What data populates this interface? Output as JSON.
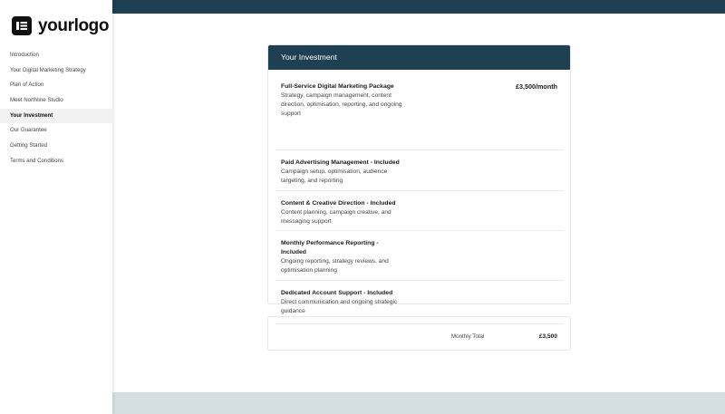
{
  "brand": {
    "logo_text": "yourlogo"
  },
  "nav": {
    "items": [
      {
        "label": "Introduction"
      },
      {
        "label": "Your Digital Marketing Strategy"
      },
      {
        "label": "Plan of Action"
      },
      {
        "label": "Meet Northline Studio"
      },
      {
        "label": "Your Investment"
      },
      {
        "label": "Our Guarantee"
      },
      {
        "label": "Getting Started"
      },
      {
        "label": "Terms and Conditions"
      }
    ],
    "active": "Your Investment"
  },
  "investment": {
    "header": "Your Investment",
    "items": [
      {
        "title": "Full-Service Digital Marketing Package",
        "description": "Strategy, campaign management, content direction, optimisation, reporting, and ongoing support",
        "price": "£3,500/month"
      },
      {
        "title": "Paid Advertising Management - Included",
        "description": "Campaign setup, optimisation, audience targeting, and reporting"
      },
      {
        "title": "Content & Creative Direction - Included",
        "description": "Content planning, campaign creative, and messaging support"
      },
      {
        "title": "Monthly Performance Reporting - Included",
        "description": "Ongoing reporting, strategy reviews, and optimisation planning"
      },
      {
        "title": "Dedicated Account Support - Included",
        "description": "Direct communication and ongoing strategic guidance"
      }
    ]
  },
  "totals": {
    "label": "Monthly Total",
    "value": "£3,500"
  },
  "colors": {
    "header_navy": "#1f3f52",
    "footer_band": "#d5dee1"
  },
  "icons": {
    "logo": "logo-mark-icon"
  }
}
